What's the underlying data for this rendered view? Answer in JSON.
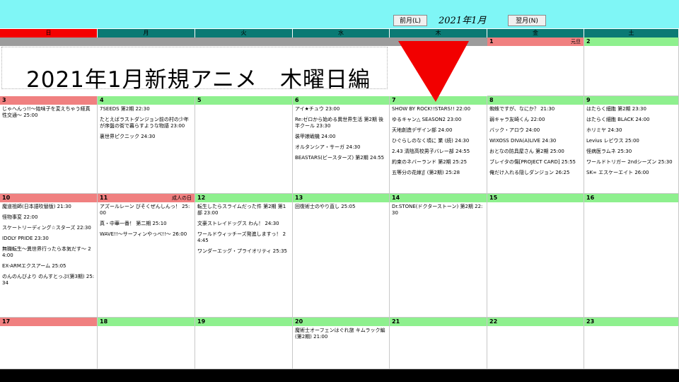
{
  "nav": {
    "prev": "前月(L)",
    "title": "2021年1月",
    "next": "翌月(N)"
  },
  "weekdays": [
    "日",
    "月",
    "火",
    "水",
    "木",
    "金",
    "土"
  ],
  "title_text": "2021年1月新規アニメ　木曜日編",
  "colors": {
    "topbar": "#7ff6f6",
    "header": "#0a7a74",
    "sunday": "#f40000",
    "day_green": "#8ef08e",
    "day_pink": "#f08080",
    "arrow": "#f20000"
  },
  "icons": {
    "arrow": "down-triangle-arrow"
  },
  "weeks": [
    [
      null,
      null,
      null,
      null,
      null,
      {
        "day": "1",
        "holiday": "元旦",
        "entries": []
      },
      {
        "day": "2",
        "entries": []
      }
    ],
    [
      {
        "day": "3",
        "entries": [
          "じゃへんっ!!～始味子を変えちゃう経真性交通～ 25:00"
        ]
      },
      {
        "day": "4",
        "entries": [
          "7SEEDS 第2期 22:30",
          "たとえばラストダンジョン前の村の少年が序盤の街で暮らすような物語 23:00",
          "裏世界ピクニック 24:30"
        ]
      },
      {
        "day": "5",
        "entries": []
      },
      {
        "day": "6",
        "entries": [
          "アイ★チュウ 23:00",
          "Re:ゼロから始める異世界生活 第2期 後半クール 23:30",
          "装甲娘戦機 24:00",
          "オルタンシア・サーガ 24:30",
          "BEASTARS(ビースターズ) 第2期 24:55"
        ]
      },
      {
        "day": "7",
        "entries": [
          "SHOW BY ROCK!!STARS!! 22:00",
          "ゆるキャン△ SEASON2 23:00",
          "天地創造デザイン部 24:00",
          "ひぐらしのなく頃に 業 (続) 24:30",
          "2.43 清陰高校男子バレー部 24:55",
          "約束のネバーランド 第2期 25:25",
          "五等分の花嫁∬ (第2期) 25:28"
        ]
      },
      {
        "day": "8",
        "entries": [
          "蜘蛛ですが、なにか？ 21:30",
          "弱キャラ友崎くん 22:00",
          "バック・アロウ 24:00",
          "WIXOSS DIVA(A)LIVE 24:30",
          "おとなの防具屋さん 第2期 25:00",
          "ブレイタの傷[PROJECT CARD] 25:55",
          "俺だけ入れる隠しダンジョン 26:25"
        ]
      },
      {
        "day": "9",
        "entries": [
          "はたらく細胞 第2期 23:30",
          "はたらく細胞 BLACK 24:00",
          "ホリミヤ 24:30",
          "Levius レビウス 25:00",
          "怪病医ラムネ 25:30",
          "ワールドトリガー 2ndシーズン 25:30",
          "SK∞ エスケーエイト 26:00"
        ]
      }
    ],
    [
      {
        "day": "10",
        "entries": [
          "魔道祖師(日本語吹替版) 21:30",
          "怪物事変 22:00",
          "スケートリーディング☆スターズ 22:30",
          "IDOLY PRIDE 23:30",
          "無職転生～異世界行ったら本気だす～ 24:00",
          "EX-ARMエクスアーム 25:05",
          "のんのんびより のんすとっぷ(第3期) 25:34"
        ]
      },
      {
        "day": "11",
        "holiday": "成人の日",
        "entries": [
          "アズールレーン びそくぜんしんっ！ 25:00",
          "真・中華一番！ 第二期 25:10",
          "WAVE!!～サーフィンやっぺ!!～ 26:00"
        ]
      },
      {
        "day": "12",
        "entries": [
          "転生したらスライムだった件 第2期 第1部 23:00",
          "文豪ストレイドッグス わん！ 24:30",
          "ワールドウィッチーズ発進しますっ！ 24:45",
          "ワンダーエッグ・プライオリティ 25:35"
        ]
      },
      {
        "day": "13",
        "entries": [
          "回復術士のやり直し 25:05"
        ]
      },
      {
        "day": "14",
        "entries": [
          "Dr.STONE(ドクターストーン) 第2期 22:30"
        ]
      },
      {
        "day": "15",
        "entries": []
      },
      {
        "day": "16",
        "entries": []
      }
    ],
    [
      {
        "day": "17",
        "entries": []
      },
      {
        "day": "18",
        "entries": []
      },
      {
        "day": "19",
        "entries": []
      },
      {
        "day": "20",
        "entries": [
          "魔術士オーフェンはぐれ旅 キムラック編 (第2期) 21:00"
        ]
      },
      {
        "day": "21",
        "entries": []
      },
      {
        "day": "22",
        "entries": []
      },
      {
        "day": "23",
        "entries": []
      }
    ]
  ]
}
